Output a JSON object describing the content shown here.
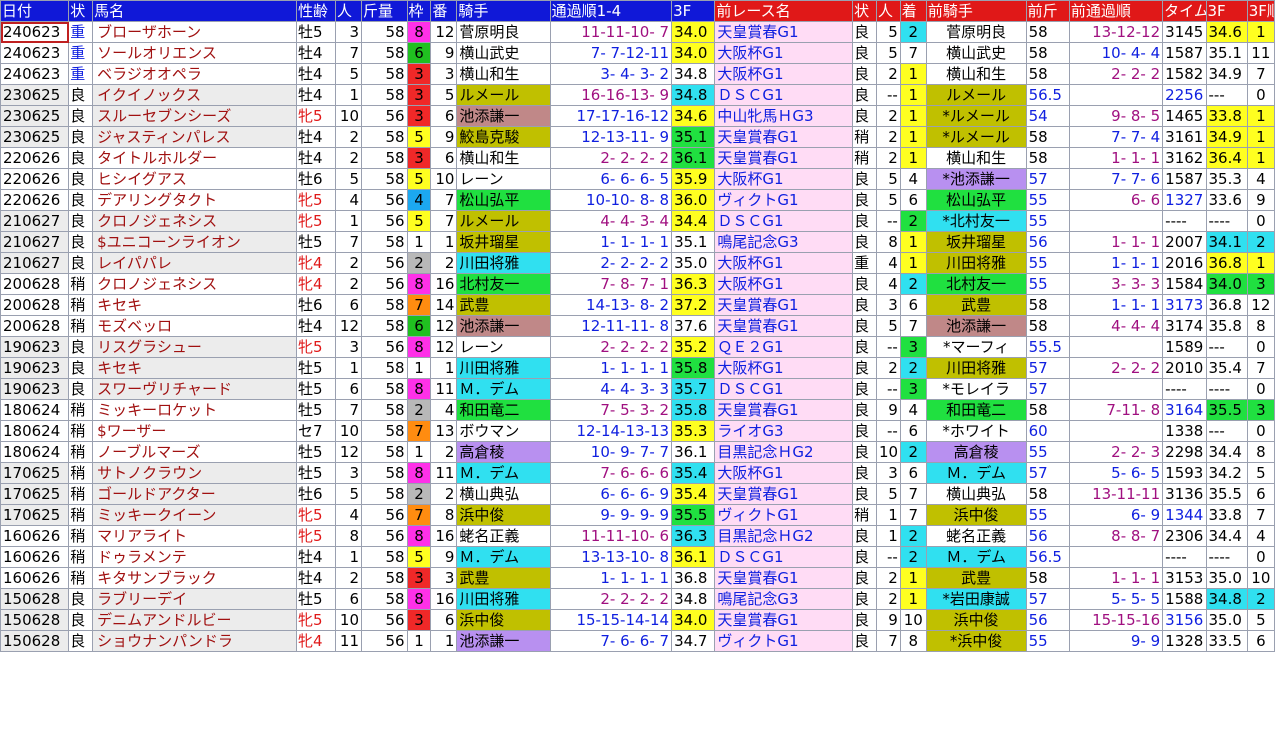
{
  "headers": [
    "日付",
    "状",
    "馬名",
    "性齢",
    "人",
    "斤量",
    "枠",
    "番",
    "騎手",
    "通過順1-4",
    "3F",
    "前レース名",
    "状",
    "人",
    "着",
    "前騎手",
    "前斤",
    "前通過順",
    "タイム",
    "3F",
    "3F順"
  ],
  "rows": [
    [
      "240623",
      "重",
      "ブローザホーン",
      "牡5",
      "3",
      "58",
      "8",
      "12",
      "菅原明良",
      "11-11-10- 7",
      "34.0",
      "天皇賞春G1",
      "良",
      "5",
      "2",
      "菅原明良",
      "58",
      "13-12-12",
      "3145",
      "34.6",
      "1"
    ],
    [
      "240623",
      "重",
      "ソールオリエンス",
      "牡4",
      "7",
      "58",
      "6",
      "9",
      "横山武史",
      "7- 7-12-11",
      "34.0",
      "大阪杯G1",
      "良",
      "5",
      "7",
      "横山武史",
      "58",
      "10- 4- 4",
      "1587",
      "35.1",
      "11"
    ],
    [
      "240623",
      "重",
      "ベラジオオペラ",
      "牡4",
      "5",
      "58",
      "3",
      "3",
      "横山和生",
      "3- 4- 3- 2",
      "34.8",
      "大阪杯G1",
      "良",
      "2",
      "1",
      "横山和生",
      "58",
      "2- 2- 2",
      "1582",
      "34.9",
      "7"
    ],
    [
      "230625",
      "良",
      "イクイノックス",
      "牡4",
      "1",
      "58",
      "3",
      "5",
      "ルメール",
      "16-16-13- 9",
      "34.8",
      "ＤＳＣG1",
      "良",
      "--",
      "1",
      "ルメール",
      "56.5",
      "",
      "2256",
      "---",
      "0"
    ],
    [
      "230625",
      "良",
      "スルーセブンシーズ",
      "牝5",
      "10",
      "56",
      "3",
      "6",
      "池添謙一",
      "17-17-16-12",
      "34.6",
      "中山牝馬ＨG3",
      "良",
      "2",
      "1",
      "*ルメール",
      "54",
      "9- 8- 5",
      "1465",
      "33.8",
      "1"
    ],
    [
      "230625",
      "良",
      "ジャスティンパレス",
      "牡4",
      "2",
      "58",
      "5",
      "9",
      "鮫島克駿",
      "12-13-11- 9",
      "35.1",
      "天皇賞春G1",
      "稍",
      "2",
      "1",
      "*ルメール",
      "58",
      "7- 7- 4",
      "3161",
      "34.9",
      "1"
    ],
    [
      "220626",
      "良",
      "タイトルホルダー",
      "牡4",
      "2",
      "58",
      "3",
      "6",
      "横山和生",
      "2- 2- 2- 2",
      "36.1",
      "天皇賞春G1",
      "稍",
      "2",
      "1",
      "横山和生",
      "58",
      "1- 1- 1",
      "3162",
      "36.4",
      "1"
    ],
    [
      "220626",
      "良",
      "ヒシイグアス",
      "牡6",
      "5",
      "58",
      "5",
      "10",
      "レーン",
      "6- 6- 6- 5",
      "35.9",
      "大阪杯G1",
      "良",
      "5",
      "4",
      "*池添謙一",
      "57",
      "7- 7- 6",
      "1587",
      "35.3",
      "4"
    ],
    [
      "220626",
      "良",
      "デアリングタクト",
      "牝5",
      "4",
      "56",
      "4",
      "7",
      "松山弘平",
      "10-10- 8- 8",
      "36.0",
      "ヴィクトG1",
      "良",
      "5",
      "6",
      "松山弘平",
      "55",
      "6- 6",
      "1327",
      "33.6",
      "9"
    ],
    [
      "210627",
      "良",
      "クロノジェネシス",
      "牝5",
      "1",
      "56",
      "5",
      "7",
      "ルメール",
      "4- 4- 3- 4",
      "34.4",
      "ＤＳＣG1",
      "良",
      "--",
      "2",
      "*北村友一",
      "55",
      "",
      "----",
      "----",
      "0"
    ],
    [
      "210627",
      "良",
      "$ユニコーンライオン",
      "牡5",
      "7",
      "58",
      "1",
      "1",
      "坂井瑠星",
      "1- 1- 1- 1",
      "35.1",
      "鳴尾記念G3",
      "良",
      "8",
      "1",
      "坂井瑠星",
      "56",
      "1- 1- 1",
      "2007",
      "34.1",
      "2"
    ],
    [
      "210627",
      "良",
      "レイパパレ",
      "牝4",
      "2",
      "56",
      "2",
      "2",
      "川田将雅",
      "2- 2- 2- 2",
      "35.0",
      "大阪杯G1",
      "重",
      "4",
      "1",
      "川田将雅",
      "55",
      "1- 1- 1",
      "2016",
      "36.8",
      "1"
    ],
    [
      "200628",
      "稍",
      "クロノジェネシス",
      "牝4",
      "2",
      "56",
      "8",
      "16",
      "北村友一",
      "7- 8- 7- 1",
      "36.3",
      "大阪杯G1",
      "良",
      "4",
      "2",
      "北村友一",
      "55",
      "3- 3- 3",
      "1584",
      "34.0",
      "3"
    ],
    [
      "200628",
      "稍",
      "キセキ",
      "牡6",
      "6",
      "58",
      "7",
      "14",
      "武豊",
      "14-13- 8- 2",
      "37.2",
      "天皇賞春G1",
      "良",
      "3",
      "6",
      "武豊",
      "58",
      "1- 1- 1",
      "3173",
      "36.8",
      "12"
    ],
    [
      "200628",
      "稍",
      "モズベッロ",
      "牡4",
      "12",
      "58",
      "6",
      "12",
      "池添謙一",
      "12-11-11- 8",
      "37.6",
      "天皇賞春G1",
      "良",
      "5",
      "7",
      "池添謙一",
      "58",
      "4- 4- 4",
      "3174",
      "35.8",
      "8"
    ],
    [
      "190623",
      "良",
      "リスグラシュー",
      "牝5",
      "3",
      "56",
      "8",
      "12",
      "レーン",
      "2- 2- 2- 2",
      "35.2",
      "ＱＥ２G1",
      "良",
      "--",
      "3",
      "*マーフィ",
      "55.5",
      "",
      "1589",
      "---",
      "0"
    ],
    [
      "190623",
      "良",
      "キセキ",
      "牡5",
      "1",
      "58",
      "1",
      "1",
      "川田将雅",
      "1- 1- 1- 1",
      "35.8",
      "大阪杯G1",
      "良",
      "2",
      "2",
      "川田将雅",
      "57",
      "2- 2- 2",
      "2010",
      "35.4",
      "7"
    ],
    [
      "190623",
      "良",
      "スワーヴリチャード",
      "牡5",
      "6",
      "58",
      "8",
      "11",
      "Ｍ．デム",
      "4- 4- 3- 3",
      "35.7",
      "ＤＳＣG1",
      "良",
      "--",
      "3",
      "*モレイラ",
      "57",
      "",
      "----",
      "----",
      "0"
    ],
    [
      "180624",
      "稍",
      "ミッキーロケット",
      "牡5",
      "7",
      "58",
      "2",
      "4",
      "和田竜二",
      "7- 5- 3- 2",
      "35.8",
      "天皇賞春G1",
      "良",
      "9",
      "4",
      "和田竜二",
      "58",
      "7-11- 8",
      "3164",
      "35.5",
      "3"
    ],
    [
      "180624",
      "稍",
      "$ワーザー",
      "セ7",
      "10",
      "58",
      "7",
      "13",
      "ボウマン",
      "12-14-13-13",
      "35.3",
      "ライオG3",
      "良",
      "--",
      "6",
      "*ホワイト",
      "60",
      "",
      "1338",
      "---",
      "0"
    ],
    [
      "180624",
      "稍",
      "ノーブルマーズ",
      "牡5",
      "12",
      "58",
      "1",
      "2",
      "高倉稜",
      "10- 9- 7- 7",
      "36.1",
      "目黒記念ＨG2",
      "良",
      "10",
      "2",
      "高倉稜",
      "55",
      "2- 2- 3",
      "2298",
      "34.4",
      "8"
    ],
    [
      "170625",
      "稍",
      "サトノクラウン",
      "牡5",
      "3",
      "58",
      "8",
      "11",
      "Ｍ．デム",
      "7- 6- 6- 6",
      "35.4",
      "大阪杯G1",
      "良",
      "3",
      "6",
      "Ｍ．デム",
      "57",
      "5- 6- 5",
      "1593",
      "34.2",
      "5"
    ],
    [
      "170625",
      "稍",
      "ゴールドアクター",
      "牡6",
      "5",
      "58",
      "2",
      "2",
      "横山典弘",
      "6- 6- 6- 9",
      "35.4",
      "天皇賞春G1",
      "良",
      "5",
      "7",
      "横山典弘",
      "58",
      "13-11-11",
      "3136",
      "35.5",
      "6"
    ],
    [
      "170625",
      "稍",
      "ミッキークイーン",
      "牝5",
      "4",
      "56",
      "7",
      "8",
      "浜中俊",
      "9- 9- 9- 9",
      "35.5",
      "ヴィクトG1",
      "稍",
      "1",
      "7",
      "浜中俊",
      "55",
      "6- 9",
      "1344",
      "33.8",
      "7"
    ],
    [
      "160626",
      "稍",
      "マリアライト",
      "牝5",
      "8",
      "56",
      "8",
      "16",
      "蛯名正義",
      "11-11-10- 6",
      "36.3",
      "目黒記念ＨG2",
      "良",
      "1",
      "2",
      "蛯名正義",
      "56",
      "8- 8- 7",
      "2306",
      "34.4",
      "4"
    ],
    [
      "160626",
      "稍",
      "ドゥラメンテ",
      "牡4",
      "1",
      "58",
      "5",
      "9",
      "Ｍ．デム",
      "13-13-10- 8",
      "36.1",
      "ＤＳＣG1",
      "良",
      "--",
      "2",
      "Ｍ．デム",
      "56.5",
      "",
      "----",
      "----",
      "0"
    ],
    [
      "160626",
      "稍",
      "キタサンブラック",
      "牡4",
      "2",
      "58",
      "3",
      "3",
      "武豊",
      "1- 1- 1- 1",
      "36.8",
      "天皇賞春G1",
      "良",
      "2",
      "1",
      "武豊",
      "58",
      "1- 1- 1",
      "3153",
      "35.0",
      "10"
    ],
    [
      "150628",
      "良",
      "ラブリーデイ",
      "牡5",
      "6",
      "58",
      "8",
      "16",
      "川田将雅",
      "2- 2- 2- 2",
      "34.8",
      "鳴尾記念G3",
      "良",
      "2",
      "1",
      "*岩田康誠",
      "57",
      "5- 5- 5",
      "1588",
      "34.8",
      "2"
    ],
    [
      "150628",
      "良",
      "デニムアンドルビー",
      "牝5",
      "10",
      "56",
      "3",
      "6",
      "浜中俊",
      "15-15-14-14",
      "34.0",
      "天皇賞春G1",
      "良",
      "9",
      "10",
      "浜中俊",
      "56",
      "15-15-16",
      "3156",
      "35.0",
      "5"
    ],
    [
      "150628",
      "良",
      "ショウナンパンドラ",
      "牝4",
      "11",
      "56",
      "1",
      "1",
      "池添謙一",
      "7- 6- 6- 7",
      "34.7",
      "ヴィクトG1",
      "良",
      "7",
      "8",
      "*浜中俊",
      "55",
      "9- 9",
      "1328",
      "33.5",
      "6"
    ]
  ],
  "jockey_colors": [
    "",
    "",
    "",
    "jy",
    "jm",
    "jy",
    "",
    "",
    "jg",
    "jy",
    "jy",
    "jc",
    "jg",
    "jy",
    "jm",
    "",
    "jc",
    "jc",
    "jg",
    "",
    "jp",
    "jc",
    "",
    "jy",
    "",
    "jc",
    "jy",
    "jc",
    "jy",
    "jp"
  ],
  "prev_jockey_colors": [
    "",
    "",
    "",
    "jy",
    "jy",
    "jy",
    "",
    "jp",
    "jg",
    "jc",
    "jy",
    "jy",
    "jg",
    "jy",
    "jm",
    "",
    "jy",
    "",
    "jg",
    "",
    "jp",
    "jc",
    "",
    "jy",
    "",
    "jc",
    "jy",
    "jc",
    "jy",
    "jy"
  ],
  "finish_colors": [
    "fc",
    "",
    "fy",
    "fy",
    "fy",
    "fy",
    "fy",
    "",
    "",
    "fg",
    "fy",
    "fy",
    "fc",
    "",
    "",
    "fg",
    "fc",
    "fg",
    "",
    "",
    "fc",
    "",
    "",
    "",
    "fc",
    "fc",
    "fy",
    "fy",
    "",
    ""
  ],
  "f3_colors": [
    "hl",
    "hl",
    "",
    "hlc",
    "hl",
    "hlg",
    "hlg",
    "hl",
    "hl",
    "hl",
    "",
    "",
    "hl",
    "hl",
    "",
    "hl",
    "hlg",
    "hlc",
    "hlc",
    "hl",
    "",
    "hlc",
    "hl",
    "hlg",
    "hlc",
    "hl",
    "",
    "",
    "hl",
    ""
  ],
  "prev_f3_colors": [
    "hl",
    "",
    "",
    "",
    "hl",
    "hl",
    "hl",
    "",
    "",
    "",
    "hlc",
    "hl",
    "hlg",
    "",
    "",
    "",
    "",
    "",
    "hlg",
    "",
    "",
    "",
    "",
    "",
    "",
    "",
    "",
    "hlc",
    "",
    ""
  ],
  "prev_rank_colors": [
    "hl",
    "",
    "",
    "",
    "hl",
    "hl",
    "hl",
    "",
    "",
    "",
    "hlc",
    "hl",
    "hlg",
    "",
    "",
    "",
    "",
    "",
    "hlg",
    "",
    "",
    "",
    "",
    "",
    "",
    "",
    "",
    "hlc",
    "",
    ""
  ]
}
